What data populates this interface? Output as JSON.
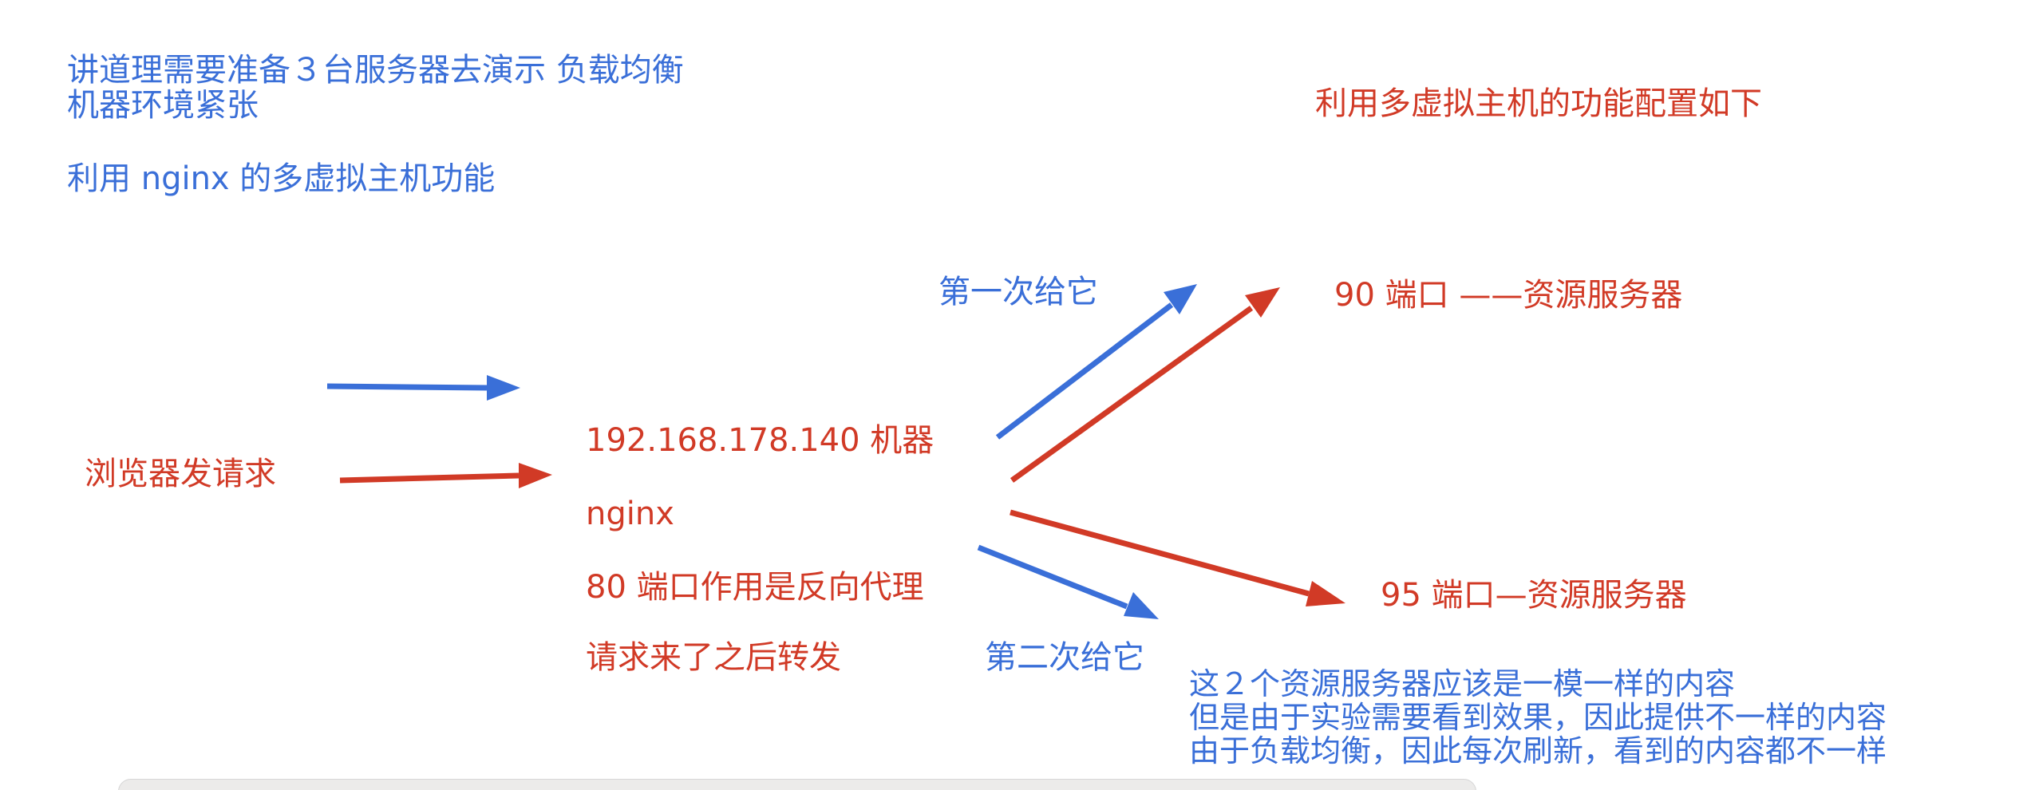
{
  "notes_left": {
    "line1": "讲道理需要准备３台服务器去演示  负载均衡",
    "line2": "机器环境紧张",
    "line3": "利用 nginx 的多虚拟主机功能"
  },
  "note_right_title": "利用多虚拟主机的功能配置如下",
  "browser_label": "浏览器发请求",
  "center": {
    "ip": "192.168.178.140 机器",
    "nginx": "nginx",
    "port80": "80 端口作用是反向代理",
    "forward": "请求来了之后转发"
  },
  "first_label": "第一次给它",
  "second_label": "第二次给它",
  "server90": "90 端口    ——资源服务器",
  "server95": "95 端口—资源服务器",
  "explanation": {
    "line1": "这２个资源服务器应该是一模一样的内容",
    "line2": "但是由于实验需要看到效果，因此提供不一样的内容",
    "line3": "由于负载均衡，因此每次刷新，看到的内容都不一样"
  },
  "colors": {
    "blue": "#3a6fd8",
    "red": "#d13a26"
  }
}
